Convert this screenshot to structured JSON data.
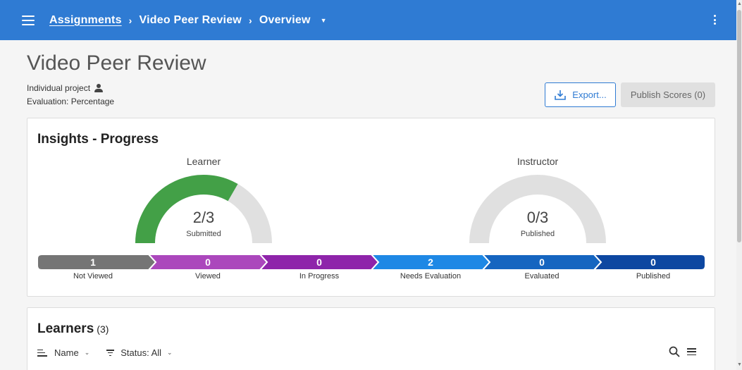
{
  "header": {
    "breadcrumbs": [
      "Assignments",
      "Video Peer Review",
      "Overview"
    ],
    "separator": "›",
    "caret": "▼"
  },
  "page": {
    "title": "Video Peer Review",
    "project_type": "Individual project",
    "evaluation": "Evaluation: Percentage",
    "export_label": "Export...",
    "publish_label": "Publish Scores (0)"
  },
  "insights": {
    "title": "Insights - Progress",
    "learner": {
      "label": "Learner",
      "value": "2/3",
      "sub": "Submitted",
      "fraction": 0.6667,
      "color": "#43a047"
    },
    "instructor": {
      "label": "Instructor",
      "value": "0/3",
      "sub": "Published",
      "fraction": 0,
      "color": "#43a047"
    },
    "steps": [
      {
        "count": "1",
        "label": "Not Viewed",
        "color": "#757575"
      },
      {
        "count": "0",
        "label": "Viewed",
        "color": "#ab47bc"
      },
      {
        "count": "0",
        "label": "In Progress",
        "color": "#8e24aa"
      },
      {
        "count": "2",
        "label": "Needs Evaluation",
        "color": "#1e88e5"
      },
      {
        "count": "0",
        "label": "Evaluated",
        "color": "#1565c0"
      },
      {
        "count": "0",
        "label": "Published",
        "color": "#0d47a1"
      }
    ]
  },
  "learners": {
    "title": "Learners",
    "count": "(3)",
    "sort_label": "Name",
    "status_label": "Status: All",
    "caret": "⌄"
  },
  "colors": {
    "header": "#2f7bd3",
    "gauge_track": "#e0e0e0"
  }
}
